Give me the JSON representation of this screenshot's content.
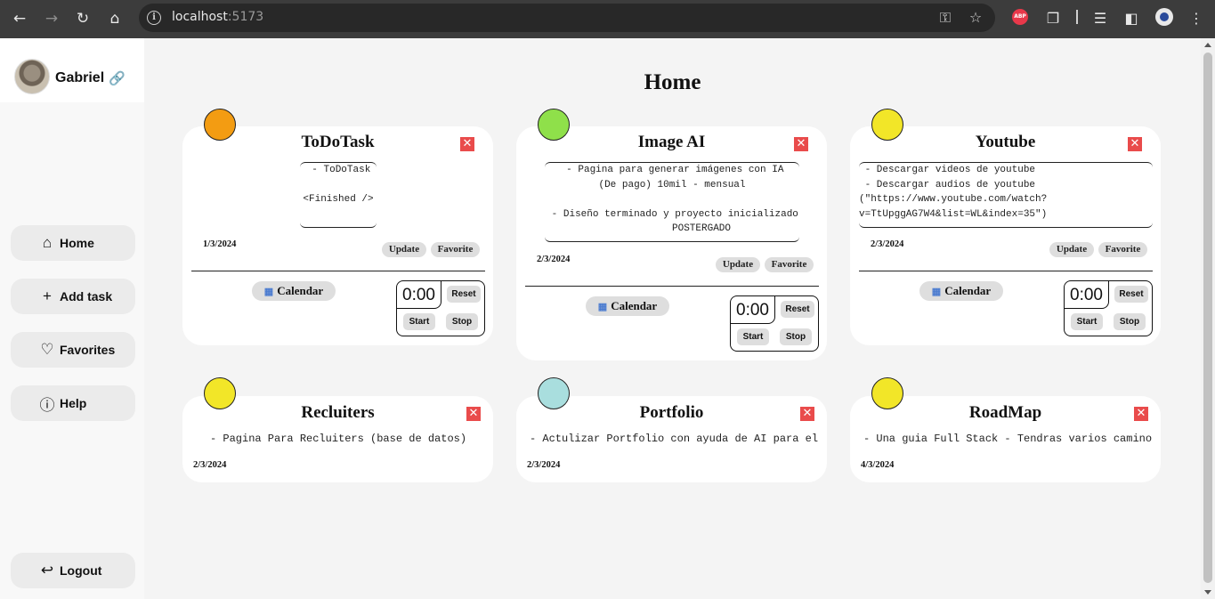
{
  "browser": {
    "url_host": "localhost",
    "url_port": ":5173"
  },
  "sidebar": {
    "username": "Gabriel",
    "items": [
      {
        "label": "Home",
        "icon": "home-icon"
      },
      {
        "label": "Add task",
        "icon": "plus-icon"
      },
      {
        "label": "Favorites",
        "icon": "heart-icon"
      },
      {
        "label": "Help",
        "icon": "help-icon"
      }
    ],
    "logout_label": "Logout"
  },
  "main": {
    "title": "Home"
  },
  "cards": [
    {
      "title": "ToDoTask",
      "description": " - ToDoTask\n\n<Finished />\n",
      "date": "1/3/2024",
      "update_label": "Update",
      "favorite_label": "Favorite",
      "calendar_label": "Calendar",
      "timer": {
        "time": "0:00",
        "reset": "Reset",
        "start": "Start",
        "stop": "Stop"
      },
      "icon_color": "#f39c12"
    },
    {
      "title": "Image AI",
      "description": " - Pagina para generar imágenes con IA\n(De pago) 10mil - mensual\n\n - Diseño terminado y proyecto inicializado\n          POSTERGADO",
      "date": "2/3/2024",
      "update_label": "Update",
      "favorite_label": "Favorite",
      "calendar_label": "Calendar",
      "timer": {
        "time": "0:00",
        "reset": "Reset",
        "start": "Start",
        "stop": "Stop"
      },
      "icon_color": "#8fe04a"
    },
    {
      "title": "Youtube",
      "description": " - Descargar videos de youtube\n - Descargar audios de youtube\n(\"https://www.youtube.com/watch?\nv=TtUpggAG7W4&list=WL&index=35\")",
      "date": "2/3/2024",
      "update_label": "Update",
      "favorite_label": "Favorite",
      "calendar_label": "Calendar",
      "timer": {
        "time": "0:00",
        "reset": "Reset",
        "start": "Start",
        "stop": "Stop"
      },
      "icon_color": "#f2e628"
    },
    {
      "title": "Recluiters",
      "description": "- Pagina Para Recluiters (base de datos)",
      "date": "2/3/2024",
      "icon_color": "#f2e628"
    },
    {
      "title": "Portfolio",
      "description": "- Actulizar Portfolio con ayuda de AI para el",
      "date": "2/3/2024",
      "icon_color": "#a9dede"
    },
    {
      "title": "RoadMap",
      "description": "- Una guia Full Stack - Tendras varios camino",
      "date": "4/3/2024",
      "icon_color": "#f2e628"
    }
  ]
}
